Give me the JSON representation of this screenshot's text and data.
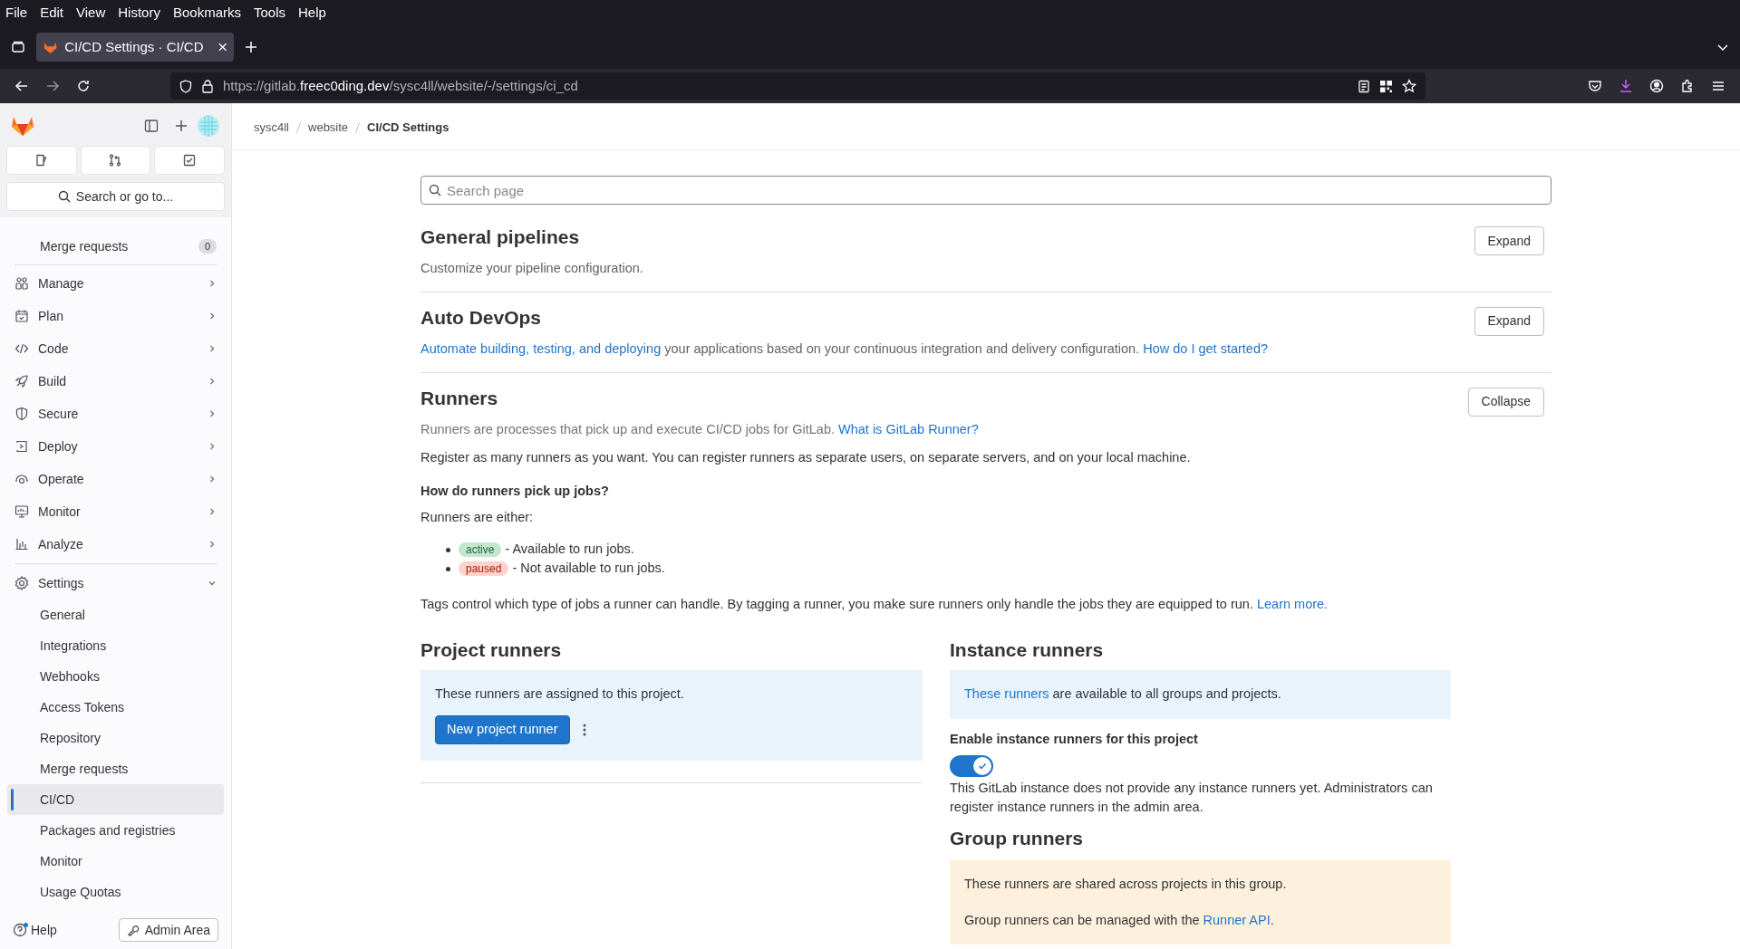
{
  "browser": {
    "menu": [
      "File",
      "Edit",
      "View",
      "History",
      "Bookmarks",
      "Tools",
      "Help"
    ],
    "tabs": [
      {
        "title": "CI/CD Settings · CI/CD",
        "selected": true
      }
    ],
    "url": {
      "prefix": "https://gitlab.",
      "domain": "freec0ding.dev",
      "path": "/sysc4ll/website/-/settings/ci_cd"
    }
  },
  "sidebar": {
    "search": "Search or go to...",
    "items": [
      {
        "kind": "link",
        "label": "Merge requests",
        "badge": "0"
      },
      {
        "kind": "group",
        "label": "Manage",
        "expanded": false
      },
      {
        "kind": "group",
        "label": "Plan",
        "expanded": false
      },
      {
        "kind": "group",
        "label": "Code",
        "expanded": false
      },
      {
        "kind": "group",
        "label": "Build",
        "expanded": false
      },
      {
        "kind": "group",
        "label": "Secure",
        "expanded": false
      },
      {
        "kind": "group",
        "label": "Deploy",
        "expanded": false
      },
      {
        "kind": "group",
        "label": "Operate",
        "expanded": false
      },
      {
        "kind": "group",
        "label": "Monitor",
        "expanded": false
      },
      {
        "kind": "group",
        "label": "Analyze",
        "expanded": false
      },
      {
        "kind": "group",
        "label": "Settings",
        "expanded": true,
        "children": [
          {
            "label": "General",
            "selected": false
          },
          {
            "label": "Integrations",
            "selected": false
          },
          {
            "label": "Webhooks",
            "selected": false
          },
          {
            "label": "Access Tokens",
            "selected": false
          },
          {
            "label": "Repository",
            "selected": false
          },
          {
            "label": "Merge requests",
            "selected": false
          },
          {
            "label": "CI/CD",
            "selected": true
          },
          {
            "label": "Packages and registries",
            "selected": false
          },
          {
            "label": "Monitor",
            "selected": false
          },
          {
            "label": "Usage Quotas",
            "selected": false
          }
        ]
      }
    ],
    "help": "Help",
    "admin": "Admin Area"
  },
  "breadcrumb": [
    "sysc4ll",
    "website",
    "CI/CD Settings"
  ],
  "search_page": {
    "placeholder": "Search page"
  },
  "sections": [
    {
      "title": "General pipelines",
      "button": "Expand",
      "description": [
        {
          "text": "Customize your pipeline configuration.",
          "link": false
        }
      ]
    },
    {
      "title": "Auto DevOps",
      "button": "Expand",
      "description": [
        {
          "text": "Automate building, testing, and deploying",
          "link": true
        },
        {
          "text": " your applications based on your continuous integration and delivery configuration. ",
          "link": false
        },
        {
          "text": "How do I get started?",
          "link": true
        }
      ]
    },
    {
      "title": "Runners",
      "button": "Collapse",
      "description": [
        {
          "text": "Runners are processes that pick up and execute CI/CD jobs for GitLab. ",
          "link": false
        },
        {
          "text": "What is GitLab Runner?",
          "link": true
        }
      ]
    }
  ],
  "runners": {
    "register": "Register as many runners as you want. You can register runners as separate users, on separate servers, and on your local machine.",
    "question": "How do runners pick up jobs?",
    "either": "Runners are either:",
    "states": [
      {
        "kind": "active",
        "badge": "active",
        "text": " - Available to run jobs."
      },
      {
        "kind": "paused",
        "badge": "paused",
        "text": " - Not available to run jobs."
      }
    ],
    "tags": [
      {
        "text": "Tags control which type of jobs a runner can handle. By tagging a runner, you make sure runners only handle the jobs they are equipped to run. ",
        "link": false
      },
      {
        "text": "Learn more.",
        "link": true
      }
    ],
    "project": {
      "title": "Project runners",
      "info": "These runners are assigned to this project.",
      "button": "New project runner"
    },
    "instance": {
      "title": "Instance runners",
      "info": [
        {
          "text": "These runners",
          "link": true
        },
        {
          "text": " are available to all groups and projects.",
          "link": false
        }
      ],
      "toggle_label": "Enable instance runners for this project",
      "toggle_on": true,
      "note": "This GitLab instance does not provide any instance runners yet. Administrators can register instance runners in the admin area."
    },
    "group": {
      "title": "Group runners",
      "lines": [
        [
          {
            "text": "These runners are shared across projects in this group.",
            "link": false
          }
        ],
        [
          {
            "text": "Group runners can be managed with the ",
            "link": false
          },
          {
            "text": "Runner API",
            "link": true
          },
          {
            "text": ".",
            "link": false
          }
        ]
      ]
    }
  }
}
